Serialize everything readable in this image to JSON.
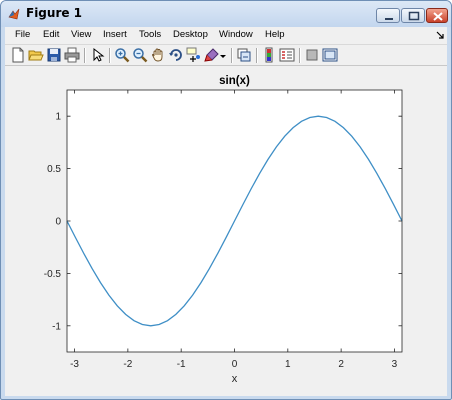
{
  "window": {
    "title": "Figure 1",
    "controls": {
      "minimize_icon": "minimize-icon",
      "maximize_icon": "maximize-icon",
      "close_icon": "close-icon"
    }
  },
  "menubar": {
    "items": [
      {
        "label": "File"
      },
      {
        "label": "Edit"
      },
      {
        "label": "View"
      },
      {
        "label": "Insert"
      },
      {
        "label": "Tools"
      },
      {
        "label": "Desktop"
      },
      {
        "label": "Window"
      },
      {
        "label": "Help"
      }
    ]
  },
  "toolbar": {
    "buttons": [
      {
        "icon": "new-figure-icon"
      },
      {
        "icon": "open-file-icon"
      },
      {
        "icon": "save-figure-icon"
      },
      {
        "icon": "print-figure-icon"
      },
      {
        "icon": "edit-plot-icon"
      },
      {
        "icon": "zoom-in-icon"
      },
      {
        "icon": "zoom-out-icon"
      },
      {
        "icon": "pan-icon"
      },
      {
        "icon": "rotate-3d-icon"
      },
      {
        "icon": "data-cursor-icon"
      },
      {
        "icon": "brush-icon"
      },
      {
        "icon": "link-plot-icon"
      },
      {
        "icon": "insert-colorbar-icon"
      },
      {
        "icon": "insert-legend-icon"
      },
      {
        "icon": "hide-plot-tools-icon"
      },
      {
        "icon": "show-plot-tools-icon"
      }
    ]
  },
  "chart_data": {
    "type": "line",
    "title": "sin(x)",
    "xlabel": "x",
    "ylabel": "",
    "xlim": [
      -3.1416,
      3.1416
    ],
    "ylim": [
      -1.25,
      1.25
    ],
    "xticks": [
      -3,
      -2,
      -1,
      0,
      1,
      2,
      3
    ],
    "yticks": [
      -1,
      -0.5,
      0,
      0.5,
      1
    ],
    "xtick_labels": [
      "-3",
      "-2",
      "-1",
      "0",
      "1",
      "2",
      "3"
    ],
    "ytick_labels": [
      "-1",
      "-0.5",
      "0",
      "0.5",
      "1"
    ],
    "grid": false,
    "series": [
      {
        "color": "#3f8fc6",
        "x": [
          -3.1416,
          -2.9845,
          -2.8274,
          -2.6704,
          -2.5133,
          -2.3562,
          -2.1991,
          -2.042,
          -1.885,
          -1.7279,
          -1.5708,
          -1.4137,
          -1.2566,
          -1.0996,
          -0.9425,
          -0.7854,
          -0.6283,
          -0.4712,
          -0.3142,
          -0.1571,
          0,
          0.1571,
          0.3142,
          0.4712,
          0.6283,
          0.7854,
          0.9425,
          1.0996,
          1.2566,
          1.4137,
          1.5708,
          1.7279,
          1.885,
          2.042,
          2.1991,
          2.3562,
          2.5133,
          2.6704,
          2.8274,
          2.9845,
          3.1416
        ],
        "y": [
          0,
          -0.1564,
          -0.309,
          -0.454,
          -0.5878,
          -0.7071,
          -0.809,
          -0.891,
          -0.9511,
          -0.9877,
          -1,
          -0.9877,
          -0.9511,
          -0.891,
          -0.809,
          -0.7071,
          -0.5878,
          -0.454,
          -0.309,
          -0.1564,
          0,
          0.1564,
          0.309,
          0.454,
          0.5878,
          0.7071,
          0.809,
          0.891,
          0.9511,
          0.9877,
          1,
          0.9877,
          0.9511,
          0.891,
          0.809,
          0.7071,
          0.5878,
          0.454,
          0.309,
          0.1564,
          0
        ]
      }
    ]
  }
}
